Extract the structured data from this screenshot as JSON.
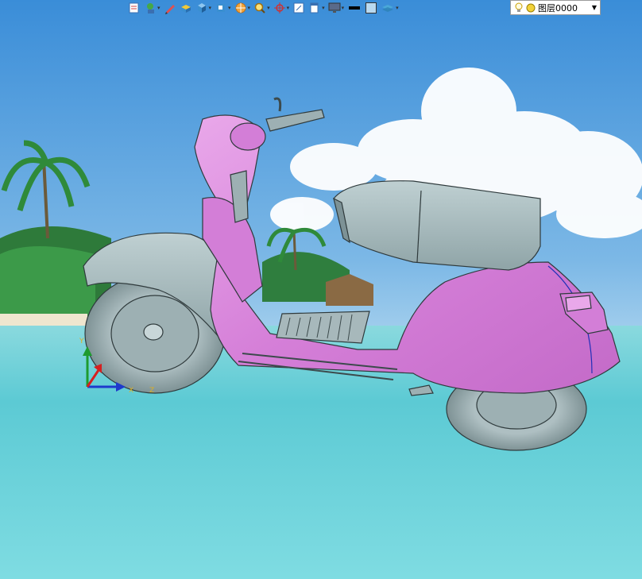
{
  "toolbar": {
    "buttons": [
      {
        "icon": "new-view-icon"
      },
      {
        "icon": "view-orientation-icon"
      },
      {
        "icon": "sketch-pencil-icon"
      },
      {
        "icon": "box-shaded-icon"
      },
      {
        "icon": "cube-view-icon"
      },
      {
        "icon": "section-view-icon"
      },
      {
        "icon": "render-style-icon"
      },
      {
        "icon": "zoom-icon"
      },
      {
        "icon": "snap-crosshair-icon"
      },
      {
        "icon": "window-fit-icon"
      },
      {
        "icon": "display-panel-icon"
      },
      {
        "icon": "monitor-icon"
      },
      {
        "icon": "line-weight-icon"
      },
      {
        "icon": "color-swatch-icon"
      },
      {
        "icon": "layers-icon"
      }
    ],
    "layer_dropdown": {
      "value": "图层0000",
      "icons": [
        "lightbulb-icon",
        "visibility-dot-icon"
      ]
    }
  },
  "scene": {
    "background": "tropical beach",
    "model": "scooter",
    "colors": {
      "body": "#D98CDB",
      "parts": "#A9BCBE",
      "sky_top": "#3D8FD6",
      "sea": "#6ED3DC"
    }
  },
  "triad": {
    "axes": [
      "x-axis",
      "y-axis",
      "z-axis"
    ]
  }
}
